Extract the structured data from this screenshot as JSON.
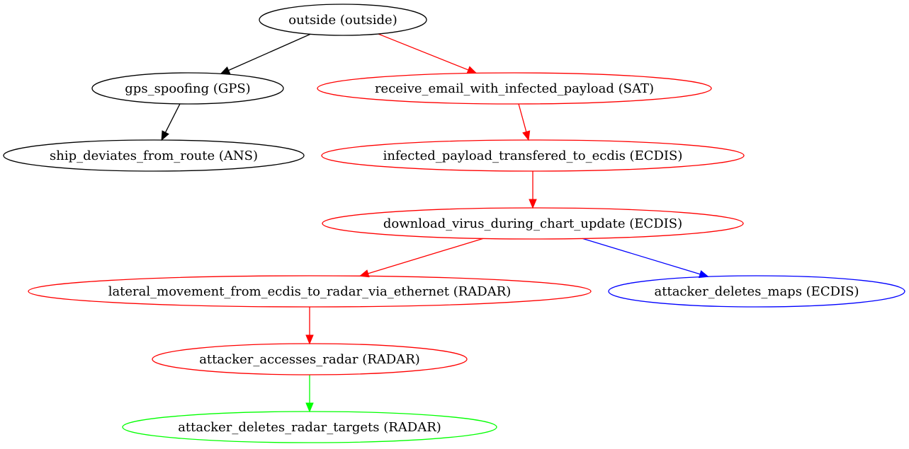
{
  "colors": {
    "black": "#000000",
    "red": "#ff0000",
    "blue": "#0000ff",
    "green": "#00ff00",
    "background": "#ffffff"
  },
  "graph": {
    "nodes": [
      {
        "id": "outside",
        "label": "outside (outside)",
        "color": "#000000"
      },
      {
        "id": "gps_spoofing",
        "label": "gps_spoofing (GPS)",
        "color": "#000000"
      },
      {
        "id": "receive_email",
        "label": "receive_email_with_infected_payload (SAT)",
        "color": "#ff0000"
      },
      {
        "id": "ship_deviates",
        "label": "ship_deviates_from_route (ANS)",
        "color": "#000000"
      },
      {
        "id": "infected_payload",
        "label": "infected_payload_transfered_to_ecdis (ECDIS)",
        "color": "#ff0000"
      },
      {
        "id": "download_virus",
        "label": "download_virus_during_chart_update (ECDIS)",
        "color": "#ff0000"
      },
      {
        "id": "lateral_movement",
        "label": "lateral_movement_from_ecdis_to_radar_via_ethernet (RADAR)",
        "color": "#ff0000"
      },
      {
        "id": "deletes_maps",
        "label": "attacker_deletes_maps (ECDIS)",
        "color": "#0000ff"
      },
      {
        "id": "accesses_radar",
        "label": "attacker_accesses_radar (RADAR)",
        "color": "#ff0000"
      },
      {
        "id": "deletes_radar_targets",
        "label": "attacker_deletes_radar_targets (RADAR)",
        "color": "#00ff00"
      }
    ],
    "edges": [
      {
        "from": "outside",
        "to": "gps_spoofing",
        "color": "#000000"
      },
      {
        "from": "outside",
        "to": "receive_email",
        "color": "#ff0000"
      },
      {
        "from": "gps_spoofing",
        "to": "ship_deviates",
        "color": "#000000"
      },
      {
        "from": "receive_email",
        "to": "infected_payload",
        "color": "#ff0000"
      },
      {
        "from": "infected_payload",
        "to": "download_virus",
        "color": "#ff0000"
      },
      {
        "from": "download_virus",
        "to": "lateral_movement",
        "color": "#ff0000"
      },
      {
        "from": "download_virus",
        "to": "deletes_maps",
        "color": "#0000ff"
      },
      {
        "from": "lateral_movement",
        "to": "accesses_radar",
        "color": "#ff0000"
      },
      {
        "from": "accesses_radar",
        "to": "deletes_radar_targets",
        "color": "#00ff00"
      }
    ]
  }
}
